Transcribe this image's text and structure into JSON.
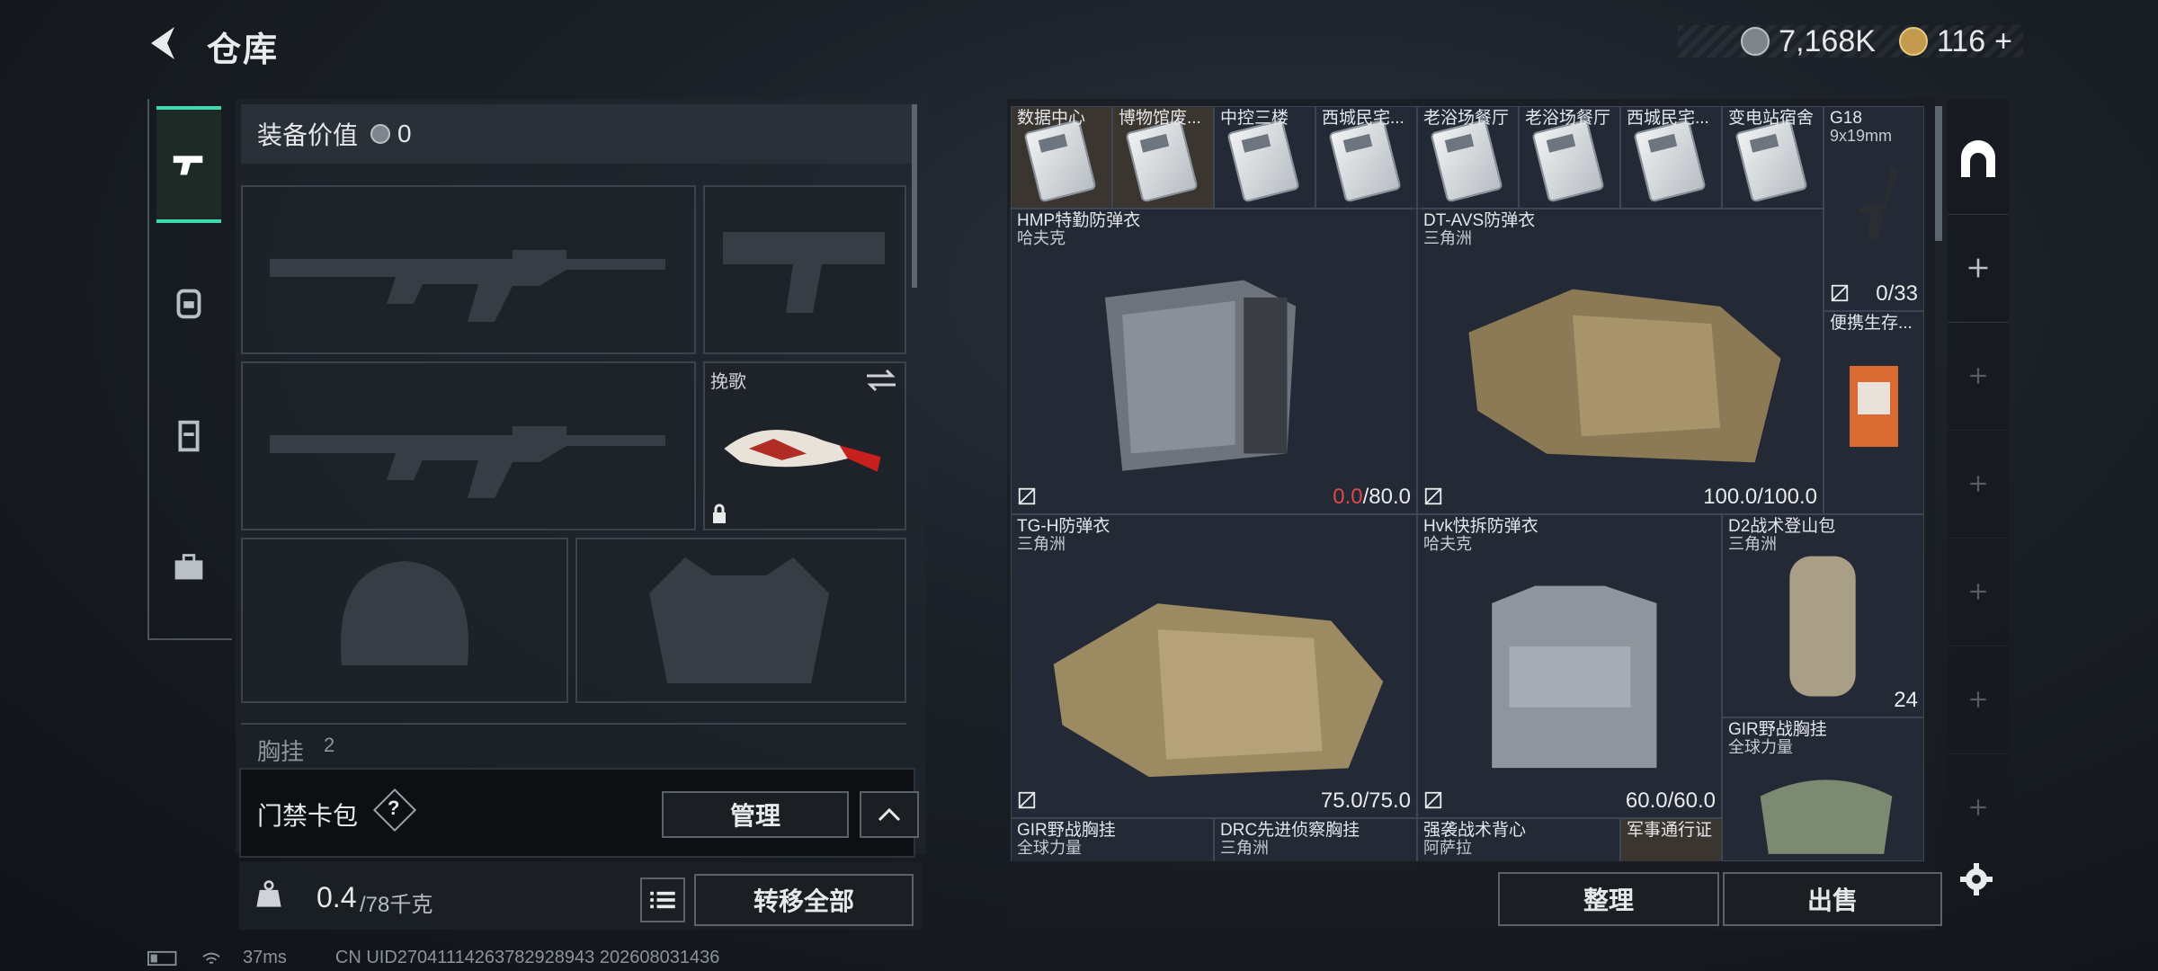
{
  "header": {
    "title": "仓库"
  },
  "currency": {
    "silver": "7,168K",
    "gold": "116",
    "gold_plus": "+"
  },
  "equipment": {
    "value_label": "装备价值",
    "value": "0",
    "melee_label": "挽歌",
    "chest_label": "胸挂",
    "chest_count": "2"
  },
  "keypack": {
    "label": "门禁卡包",
    "help": "?",
    "manage": "管理"
  },
  "weight": {
    "current": "0.4",
    "max": "/78千克",
    "transfer": "转移全部"
  },
  "storage": {
    "cards": [
      {
        "label": "数据中心",
        "brown": true
      },
      {
        "label": "博物馆废...",
        "brown": true
      },
      {
        "label": "中控三楼",
        "brown": false
      },
      {
        "label": "西城民宅...",
        "brown": false
      },
      {
        "label": "老浴场餐厅",
        "brown": false
      },
      {
        "label": "老浴场餐厅",
        "brown": false
      },
      {
        "label": "西城民宅...",
        "brown": false
      },
      {
        "label": "变电站宿舍",
        "brown": false
      }
    ],
    "items": [
      {
        "name": "HMP特勤防弹衣",
        "maker": "哈夫克",
        "dur_cur": "0.0",
        "dur_max": "/80.0"
      },
      {
        "name": "DT-AVS防弹衣",
        "maker": "三角洲",
        "dur": "100.0/100.0"
      },
      {
        "name": "TG-H防弹衣",
        "maker": "三角洲",
        "dur": "75.0/75.0"
      },
      {
        "name": "Hvk快拆防弹衣",
        "maker": "哈夫克",
        "dur": "60.0/60.0"
      },
      {
        "name": "D2战术登山包",
        "maker": "三角洲",
        "count": "24"
      },
      {
        "name": "GIR野战胸挂",
        "maker": "全球力量"
      }
    ],
    "g18": {
      "name": "G18",
      "caliber": "9x19mm",
      "ammo": "0/33"
    },
    "portable": {
      "name": "便携生存..."
    },
    "bottom_row": [
      {
        "name": "GIR野战胸挂",
        "maker": "全球力量"
      },
      {
        "name": "DRC先进侦察胸挂",
        "maker": "三角洲"
      },
      {
        "name": "强袭战术背心",
        "maker": "阿萨拉"
      },
      {
        "name": "军事通行证",
        "maker": ""
      }
    ],
    "sort": "整理",
    "sell": "出售"
  },
  "status": {
    "ping": "37ms",
    "uid": "CN UID27041114263782928943 202608031436"
  }
}
